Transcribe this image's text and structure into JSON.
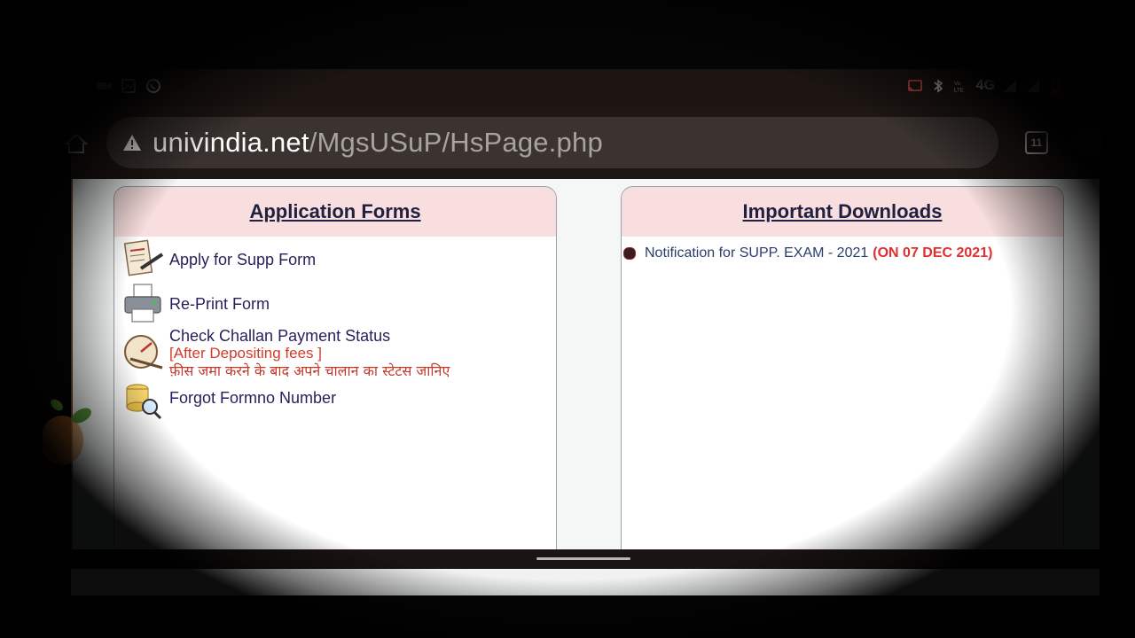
{
  "browser": {
    "url_domain": "univindia.net",
    "url_path": "/MgsUSuP/HsPage.php",
    "tab_count": "11",
    "status_network": "4G"
  },
  "left_panel": {
    "title": "Application Forms",
    "items": [
      {
        "label": "Apply for Supp Form",
        "icon": "form-pen-icon"
      },
      {
        "label": "Re-Print Form",
        "icon": "printer-icon"
      },
      {
        "label": "Check Challan Payment Status",
        "sub": "[After Depositing fees ]",
        "hindi": "फ़ीस जमा करने के बाद अपने चालान का स्टेटस जानिए",
        "icon": "gauge-icon"
      },
      {
        "label": "Forgot Formno Number",
        "icon": "search-database-icon"
      }
    ]
  },
  "right_panel": {
    "title": "Important Downloads",
    "notifications": [
      {
        "text": "Notification for SUPP. EXAM - 2021",
        "date": "(ON 07 DEC 2021)"
      }
    ]
  },
  "colors": {
    "header_bg": "#f8dede",
    "title": "#202040",
    "link": "#2b1d5a",
    "accent_red": "#d23b2b"
  }
}
